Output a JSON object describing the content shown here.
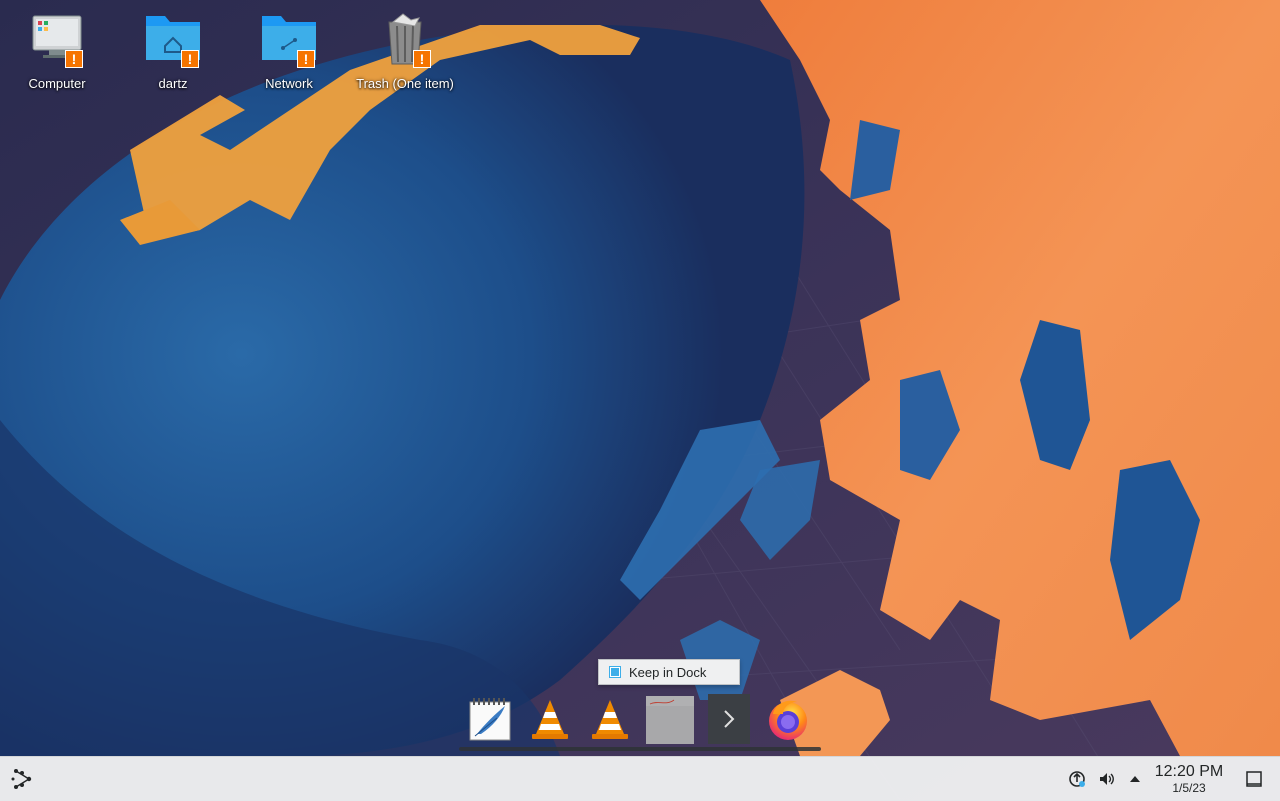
{
  "desktop": {
    "icons": [
      {
        "label": "Computer",
        "icon": "computer-icon",
        "badge": "!"
      },
      {
        "label": "dartz",
        "icon": "home-folder-icon",
        "badge": "!"
      },
      {
        "label": "Network",
        "icon": "network-folder-icon",
        "badge": "!"
      },
      {
        "label": "Trash (One item)",
        "icon": "trash-icon",
        "badge": "!"
      }
    ]
  },
  "dock": {
    "popup_label": "Keep in Dock",
    "popup_checked": true,
    "items": [
      {
        "name": "text-editor-icon"
      },
      {
        "name": "vlc-icon"
      },
      {
        "name": "vlc-icon"
      },
      {
        "name": "document-window-thumbnail"
      },
      {
        "name": "chevron-right-icon"
      },
      {
        "name": "firefox-icon"
      }
    ]
  },
  "panel": {
    "launcher_icon": "application-launcher-icon",
    "tray_icons": [
      "updates-icon",
      "volume-icon",
      "expand-tray-icon"
    ],
    "clock_time": "12:20 PM",
    "clock_date": "1/5/23",
    "show_desktop_icon": "show-desktop-icon"
  },
  "colors": {
    "accent": "#3daee9",
    "badge": "#f67400",
    "panel_bg": "#eff0f1",
    "wallpaper_orange": "#f28a45",
    "wallpaper_blue": "#1f5d9c"
  }
}
